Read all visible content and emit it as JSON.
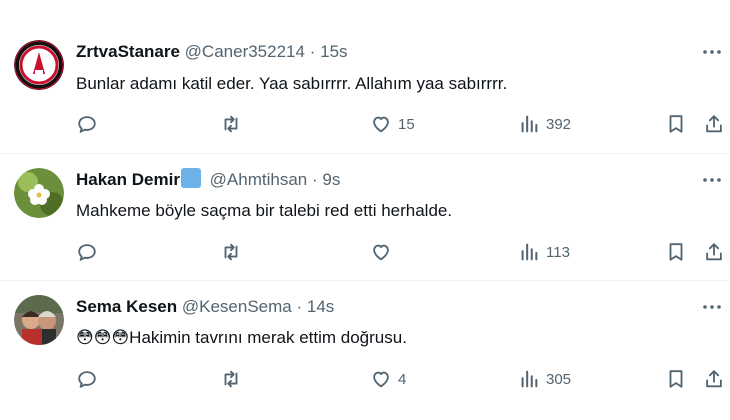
{
  "tweets": [
    {
      "name": "ZrtvaStanare",
      "handle": "@Caner352214",
      "separator": "·",
      "time": "15s",
      "text": "Bunlar adamı katil eder. Yaa sabırrrr. Allahım yaa sabırrrr.",
      "likes": "15",
      "views": "392",
      "verified": false
    },
    {
      "name": "Hakan Demir",
      "handle": "@Ahmtihsan",
      "separator": "·",
      "time": "9s",
      "text": "Mahkeme böyle saçma bir talebi red etti herhalde.",
      "likes": "",
      "views": "113",
      "verified": true
    },
    {
      "name": "Sema Kesen",
      "handle": "@KesenSema",
      "separator": "·",
      "time": "14s",
      "emoji": "😳😳😳",
      "text": "Hakimin tavrını merak ettim doğrusu.",
      "likes": "4",
      "views": "305",
      "verified": false
    }
  ],
  "colors": {
    "text": "#0f1419",
    "muted": "#536471",
    "divider": "#eff3f4",
    "verified_badge": "#6cb2e8"
  },
  "icons": [
    "reply-icon",
    "retweet-icon",
    "like-icon",
    "views-icon",
    "bookmark-icon",
    "share-icon",
    "more-icon"
  ]
}
